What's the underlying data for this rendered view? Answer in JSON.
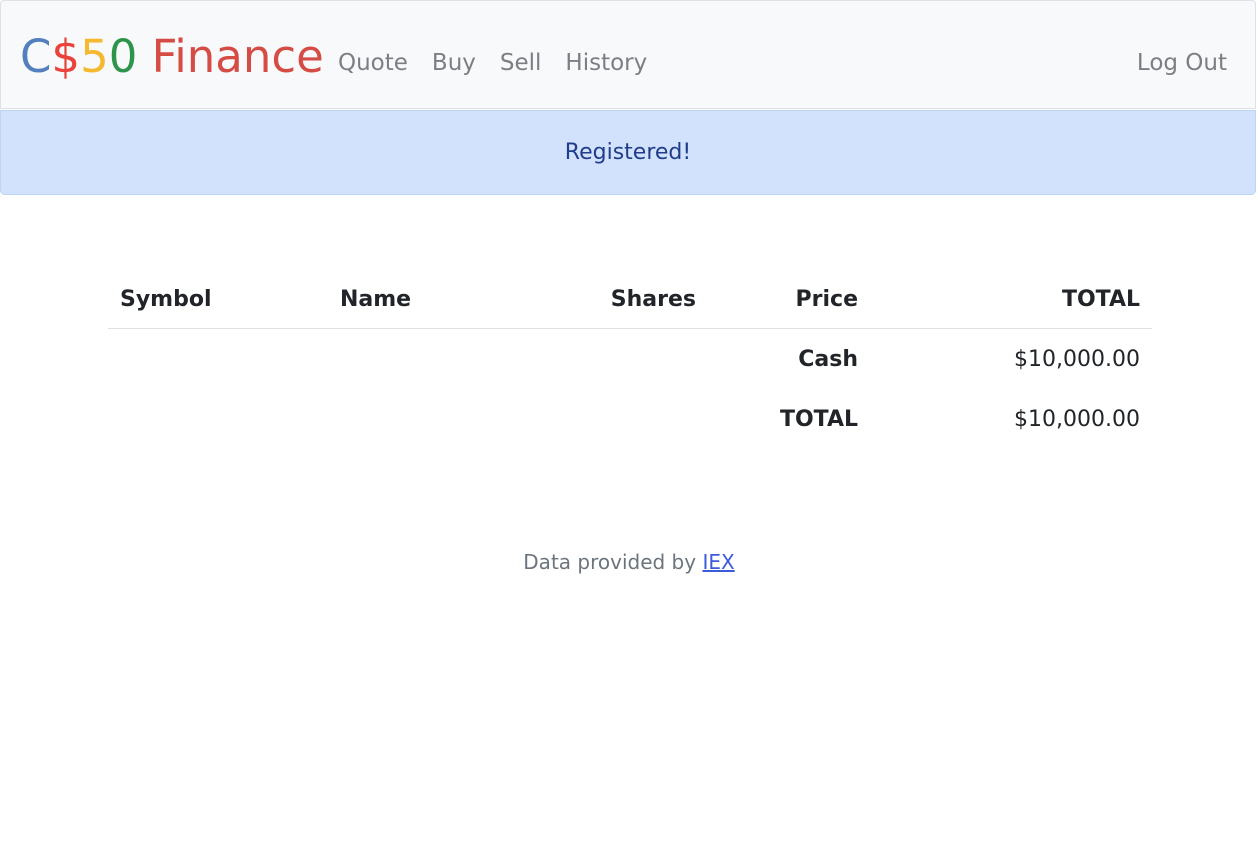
{
  "navbar": {
    "brand": {
      "parts": [
        {
          "text": "C",
          "color": "#537fbe"
        },
        {
          "text": "$",
          "color": "#ea433b"
        },
        {
          "text": "5",
          "color": "#f5b82e"
        },
        {
          "text": "0",
          "color": "#2e944b"
        },
        {
          "text": " Finance",
          "color": "#d54c45"
        }
      ]
    },
    "links": [
      {
        "label": "Quote"
      },
      {
        "label": "Buy"
      },
      {
        "label": "Sell"
      },
      {
        "label": "History"
      }
    ],
    "logout_label": "Log Out"
  },
  "alert": {
    "message": "Registered!"
  },
  "table": {
    "headers": {
      "symbol": "Symbol",
      "name": "Name",
      "shares": "Shares",
      "price": "Price",
      "total": "TOTAL"
    },
    "rows": [
      {
        "label": "Cash",
        "value": "$10,000.00"
      },
      {
        "label": "TOTAL",
        "value": "$10,000.00"
      }
    ]
  },
  "footer": {
    "prefix": "Data provided by ",
    "link_label": "IEX"
  }
}
